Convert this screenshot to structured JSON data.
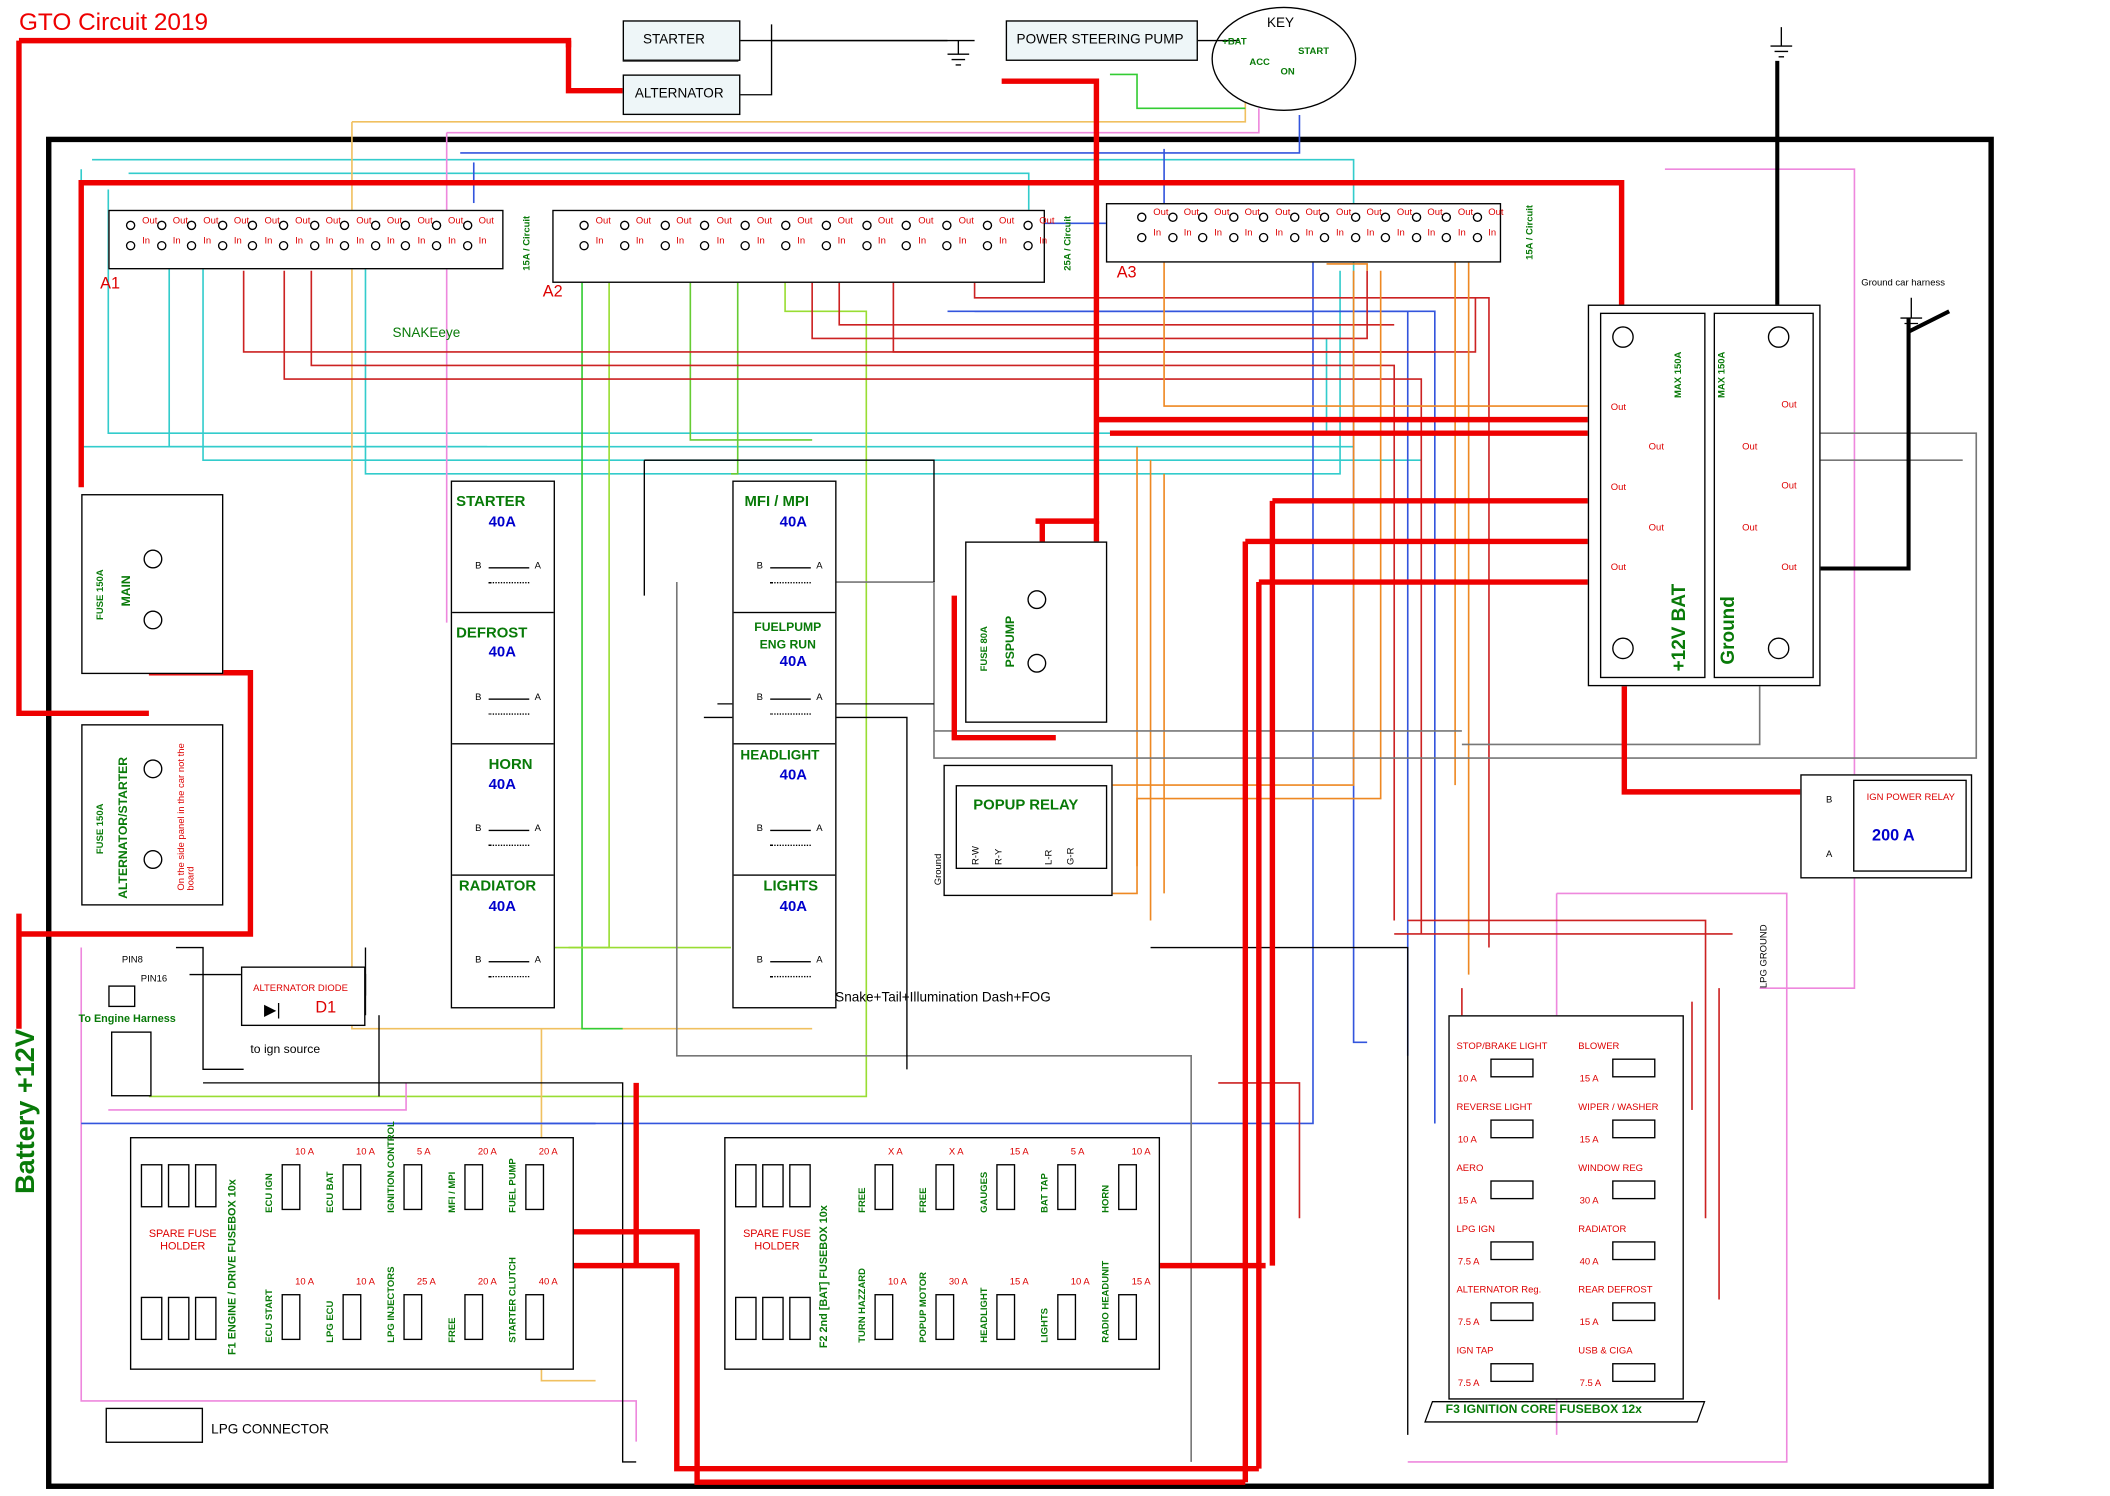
{
  "title": "GTO Circuit 2019",
  "battery_label": "Battery +12V",
  "top_boxes": {
    "starter": "STARTER",
    "alternator": "ALTERNATOR",
    "pump": "POWER STEERING PUMP"
  },
  "key": {
    "title": "KEY",
    "bat": "+BAT",
    "acc": "ACC",
    "on": "ON",
    "start": "START"
  },
  "bus": {
    "a1": "A1",
    "a2": "A2",
    "a3": "A3",
    "a1_rating": "15A / Circuit",
    "a2_rating": "25A / Circuit",
    "a3_rating": "15A / Circuit",
    "out": "Out",
    "in": "In",
    "snake_eye": "SNAKEeye"
  },
  "main_fuse": {
    "fuse": "FUSE 150A",
    "name": "MAIN"
  },
  "alt_fuse": {
    "fuse": "FUSE 150A",
    "name": "ALTERNATOR/STARTER",
    "note": "On the side panel in the car not the board"
  },
  "pspump_fuse": {
    "fuse": "FUSE 80A",
    "name": "PSPUMP"
  },
  "relays_left": [
    {
      "name": "STARTER",
      "amps": "40A"
    },
    {
      "name": "DEFROST",
      "amps": "40A"
    },
    {
      "name": "HORN",
      "amps": "40A"
    },
    {
      "name": "RADIATOR",
      "amps": "40A"
    }
  ],
  "relays_right": [
    {
      "name": "MFI / MPI",
      "amps": "40A"
    },
    {
      "name": "FUELPUMP ENG RUN",
      "amps": "40A"
    },
    {
      "name": "HEADLIGHT",
      "amps": "40A"
    },
    {
      "name": "LIGHTS",
      "amps": "40A"
    }
  ],
  "relay_pins": {
    "b": "B",
    "a": "A"
  },
  "lights_note": "Snake+Tail+Illumination Dash+FOG",
  "popup": {
    "title": "POPUP RELAY",
    "ground": "Ground",
    "pins": [
      "R-W",
      "R-Y",
      "L-R",
      "G-R"
    ]
  },
  "distribution": {
    "bat": "+12V BAT",
    "ground": "Ground",
    "max1": "MAX 150A",
    "max2": "MAX 150A",
    "out": "Out",
    "harness": "Ground car harness"
  },
  "ign_relay": {
    "title": "IGN POWER RELAY",
    "amps": "200 A",
    "b": "B",
    "a": "A"
  },
  "lpg_ground": "LPG GROUND",
  "engine_harness": {
    "pin8": "PIN8",
    "pin16": "PIN16",
    "title": "To Engine Harness",
    "ign": "to ign source"
  },
  "diode": {
    "title": "ALTERNATOR DIODE",
    "name": "D1"
  },
  "lpg_connector": "LPG CONNECTOR",
  "f1": {
    "title": "F1 ENGINE / DRIVE FUSEBOX 10x",
    "spare": "SPARE FUSE HOLDER",
    "top": [
      {
        "a": "10 A",
        "n": "ECU IGN"
      },
      {
        "a": "10 A",
        "n": "ECU BAT"
      },
      {
        "a": "5 A",
        "n": "IGNITION CONTROL"
      },
      {
        "a": "20 A",
        "n": "MFI / MPI"
      },
      {
        "a": "20 A",
        "n": "FUEL PUMP"
      }
    ],
    "bottom": [
      {
        "a": "10 A",
        "n": "ECU START"
      },
      {
        "a": "10 A",
        "n": "LPG ECU"
      },
      {
        "a": "25 A",
        "n": "LPG INJECTORS"
      },
      {
        "a": "20 A",
        "n": "FREE"
      },
      {
        "a": "40 A",
        "n": "STARTER CLUTCH"
      }
    ]
  },
  "f2": {
    "title": "F2 2nd [BAT] FUSEBOX 10x",
    "spare": "SPARE FUSE HOLDER",
    "top": [
      {
        "a": "X A",
        "n": "FREE"
      },
      {
        "a": "X A",
        "n": "FREE"
      },
      {
        "a": "15 A",
        "n": "GAUGES"
      },
      {
        "a": "5 A",
        "n": "BAT TAP"
      },
      {
        "a": "10 A",
        "n": "HORN"
      }
    ],
    "bottom": [
      {
        "a": "10 A",
        "n": "TURN HAZZARD"
      },
      {
        "a": "30 A",
        "n": "POPUP MOTOR"
      },
      {
        "a": "15 A",
        "n": "HEADLIGHT"
      },
      {
        "a": "10 A",
        "n": "LIGHTS"
      },
      {
        "a": "15 A",
        "n": "RADIO HEADUNIT"
      }
    ]
  },
  "f3": {
    "title": "F3 IGNITION CORE FUSEBOX 12x",
    "left": [
      {
        "n": "STOP/BRAKE LIGHT",
        "a": "10 A"
      },
      {
        "n": "REVERSE LIGHT",
        "a": "10 A"
      },
      {
        "n": "AERO",
        "a": "15 A"
      },
      {
        "n": "LPG IGN",
        "a": "7.5 A"
      },
      {
        "n": "ALTERNATOR Reg.",
        "a": "7.5 A"
      },
      {
        "n": "IGN TAP",
        "a": "7.5 A"
      }
    ],
    "right": [
      {
        "n": "BLOWER",
        "a": "15 A"
      },
      {
        "n": "WIPER / WASHER",
        "a": "15 A"
      },
      {
        "n": "WINDOW REG",
        "a": "30 A"
      },
      {
        "n": "RADIATOR",
        "a": "40 A"
      },
      {
        "n": "REAR DEFROST",
        "a": "15 A"
      },
      {
        "n": "USB & CIGA",
        "a": "7.5 A"
      }
    ]
  },
  "colors": {
    "power": "#ee0000",
    "ground": "#000000",
    "label_green": "#087a08",
    "label_blue": "#0000cc"
  }
}
